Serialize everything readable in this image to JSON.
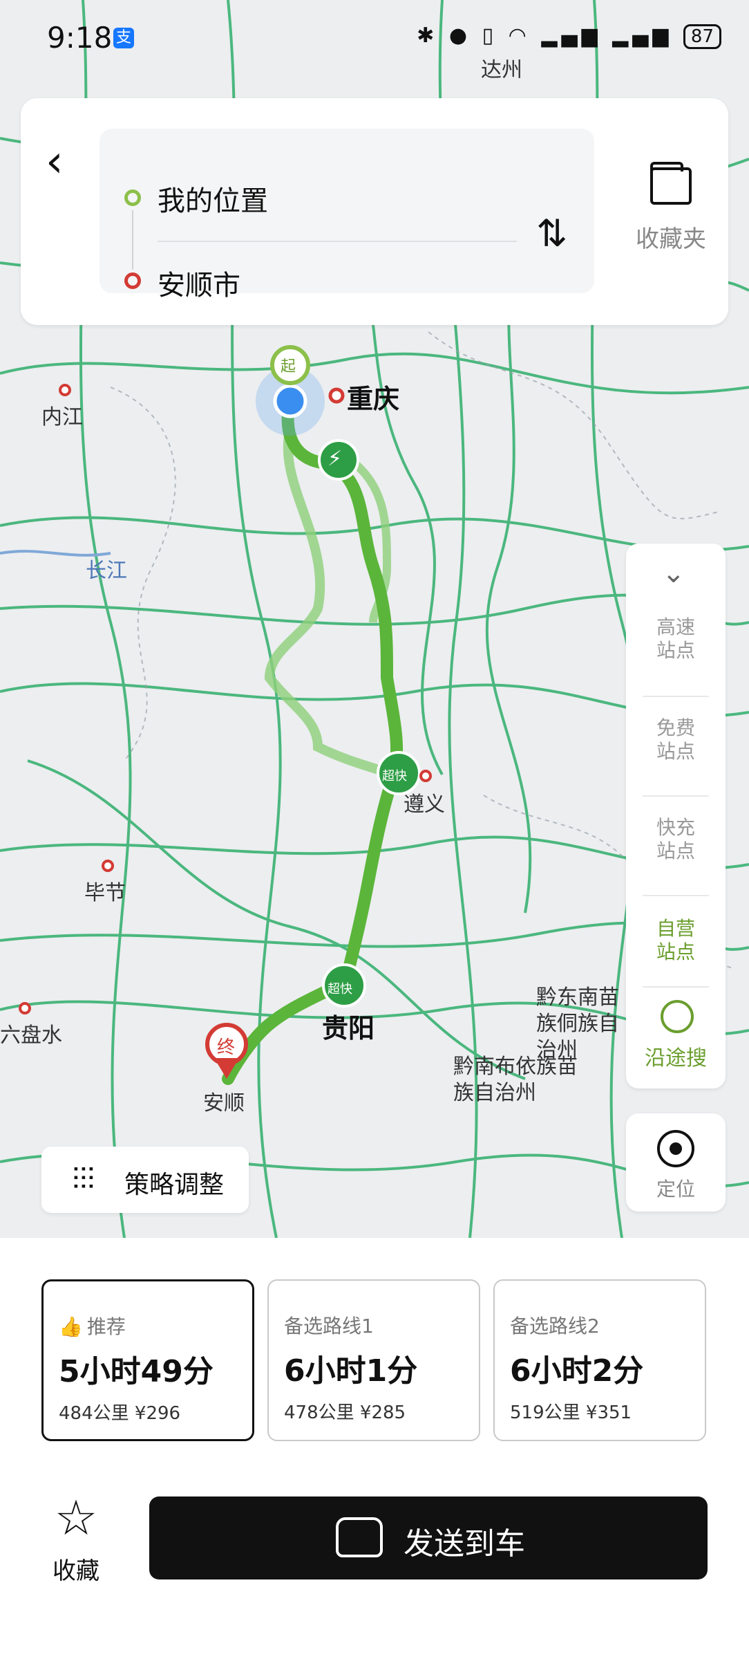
{
  "status_bar": {
    "time": "9:18",
    "pay_badge": "支",
    "battery": "87"
  },
  "route": {
    "origin": "我的位置",
    "destination": "安顺市"
  },
  "favorites_label": "收藏夹",
  "map_labels": {
    "dazhou": "达州",
    "neijiang": "内江",
    "chongqing": "重庆",
    "changjiang": "长江",
    "zunyi": "遵义",
    "bijie": "毕节",
    "guiyang": "贵阳",
    "anshun": "安顺",
    "liupanshui": "六盘水",
    "qiandongnan": "黔东南苗族侗族自治州",
    "qiannan": "黔南布依族苗族自治州"
  },
  "map_markers": {
    "start": "起",
    "end": "终",
    "station": "超快"
  },
  "side_panel": {
    "items": [
      "高速站点",
      "免费站点",
      "快充站点",
      "自营站点"
    ],
    "along_search": "沿途搜"
  },
  "locate_label": "定位",
  "strategy_label": "策略调整",
  "routes": [
    {
      "tag": "推荐",
      "duration": "5小时49分",
      "distance": "484公里",
      "cost": "¥296",
      "selected": true
    },
    {
      "tag": "备选路线1",
      "duration": "6小时1分",
      "distance": "478公里",
      "cost": "¥285",
      "selected": false
    },
    {
      "tag": "备选路线2",
      "duration": "6小时2分",
      "distance": "519公里",
      "cost": "¥351",
      "selected": false
    }
  ],
  "collect_label": "收藏",
  "send_label": "发送到车",
  "colors": {
    "route_green": "#5bb53a",
    "alt_route_green": "#8fd07a",
    "end_red": "#d33b34",
    "active_green": "#6b9e2e",
    "button_dark": "#111111"
  }
}
